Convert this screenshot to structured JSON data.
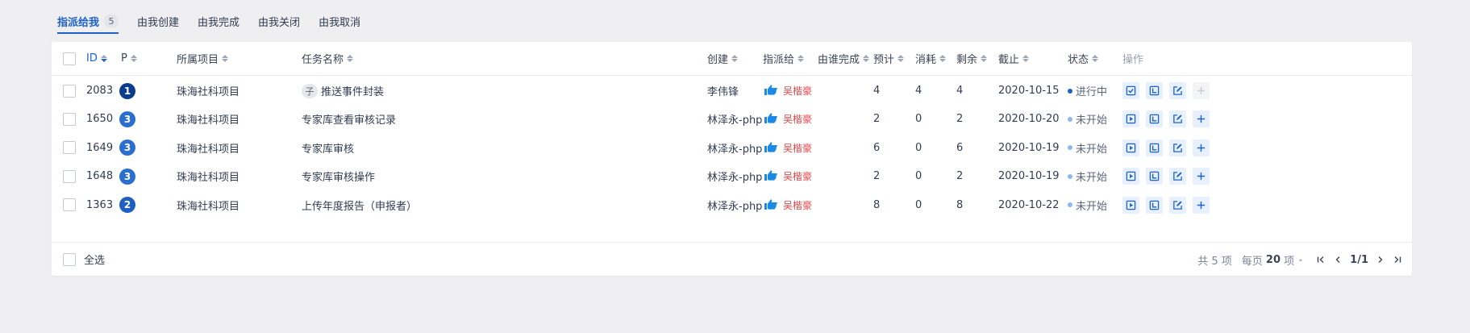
{
  "tabs": [
    {
      "label": "指派给我",
      "count": "5",
      "active": true
    },
    {
      "label": "由我创建"
    },
    {
      "label": "由我完成"
    },
    {
      "label": "由我关闭"
    },
    {
      "label": "由我取消"
    }
  ],
  "columns": {
    "id": "ID",
    "pri": "P",
    "project": "所属项目",
    "name": "任务名称",
    "creator": "创建",
    "assignee": "指派给",
    "finishedBy": "由谁完成",
    "estimate": "预计",
    "consumed": "消耗",
    "left": "剩余",
    "deadline": "截止",
    "status": "状态",
    "actions": "操作"
  },
  "rows": [
    {
      "id": "2083",
      "pri": "1",
      "project": "珠海社科项目",
      "child_tag": "子",
      "name": "推送事件封装",
      "creator": "李伟锋",
      "assignee": "吴楷豪",
      "finishedBy": "",
      "estimate": "4",
      "consumed": "4",
      "left": "4",
      "deadline": "2020-10-15",
      "status": "进行中",
      "status_key": "doing"
    },
    {
      "id": "1650",
      "pri": "3",
      "project": "珠海社科项目",
      "child_tag": "",
      "name": "专家库查看审核记录",
      "creator": "林泽永-php",
      "assignee": "吴楷豪",
      "finishedBy": "",
      "estimate": "2",
      "consumed": "0",
      "left": "2",
      "deadline": "2020-10-20",
      "status": "未开始",
      "status_key": "wait"
    },
    {
      "id": "1649",
      "pri": "3",
      "project": "珠海社科项目",
      "child_tag": "",
      "name": "专家库审核",
      "creator": "林泽永-php",
      "assignee": "吴楷豪",
      "finishedBy": "",
      "estimate": "6",
      "consumed": "0",
      "left": "6",
      "deadline": "2020-10-19",
      "status": "未开始",
      "status_key": "wait"
    },
    {
      "id": "1648",
      "pri": "3",
      "project": "珠海社科项目",
      "child_tag": "",
      "name": "专家库审核操作",
      "creator": "林泽永-php",
      "assignee": "吴楷豪",
      "finishedBy": "",
      "estimate": "2",
      "consumed": "0",
      "left": "2",
      "deadline": "2020-10-19",
      "status": "未开始",
      "status_key": "wait"
    },
    {
      "id": "1363",
      "pri": "2",
      "project": "珠海社科项目",
      "child_tag": "",
      "name": "上传年度报告（申报者）",
      "creator": "林泽永-php",
      "assignee": "吴楷豪",
      "finishedBy": "",
      "estimate": "8",
      "consumed": "0",
      "left": "8",
      "deadline": "2020-10-22",
      "status": "未开始",
      "status_key": "wait"
    }
  ],
  "footer": {
    "select_all": "全选",
    "total": "共 5 项",
    "per_page_prefix": "每页",
    "per_page": "20",
    "per_page_suffix": "项",
    "page": "1/1"
  },
  "colors": {
    "accent": "#1d62c8",
    "assignee": "#e5474b",
    "status_doing": "#1d62c8",
    "status_wait": "#8ab9f0"
  }
}
